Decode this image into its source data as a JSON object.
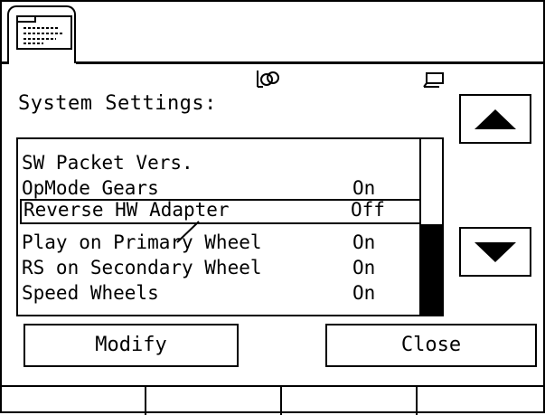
{
  "title": "System Settings:",
  "list": {
    "items": [
      {
        "label": "SW Packet Vers.",
        "value": ""
      },
      {
        "label": "OpMode Gears",
        "value": "On"
      },
      {
        "label": "Reverse HW Adapter",
        "value": "Off",
        "selected": true
      },
      {
        "label": "Play on Primary Wheel",
        "value": "On"
      },
      {
        "label": "RS on Secondary Wheel",
        "value": "On"
      },
      {
        "label": "Speed Wheels",
        "value": "On"
      }
    ],
    "scroll_position_fraction": 0.5
  },
  "buttons": {
    "modify": "Modify",
    "close": "Close"
  },
  "icons": {
    "tab": "settings-document-icon",
    "status_left": "link-icon",
    "status_right": "screen-icon",
    "up": "arrow-up-icon",
    "down": "arrow-down-icon"
  },
  "softkeys": [
    "",
    "",
    "",
    ""
  ],
  "colors": {
    "foreground": "#000000",
    "background": "#ffffff"
  }
}
